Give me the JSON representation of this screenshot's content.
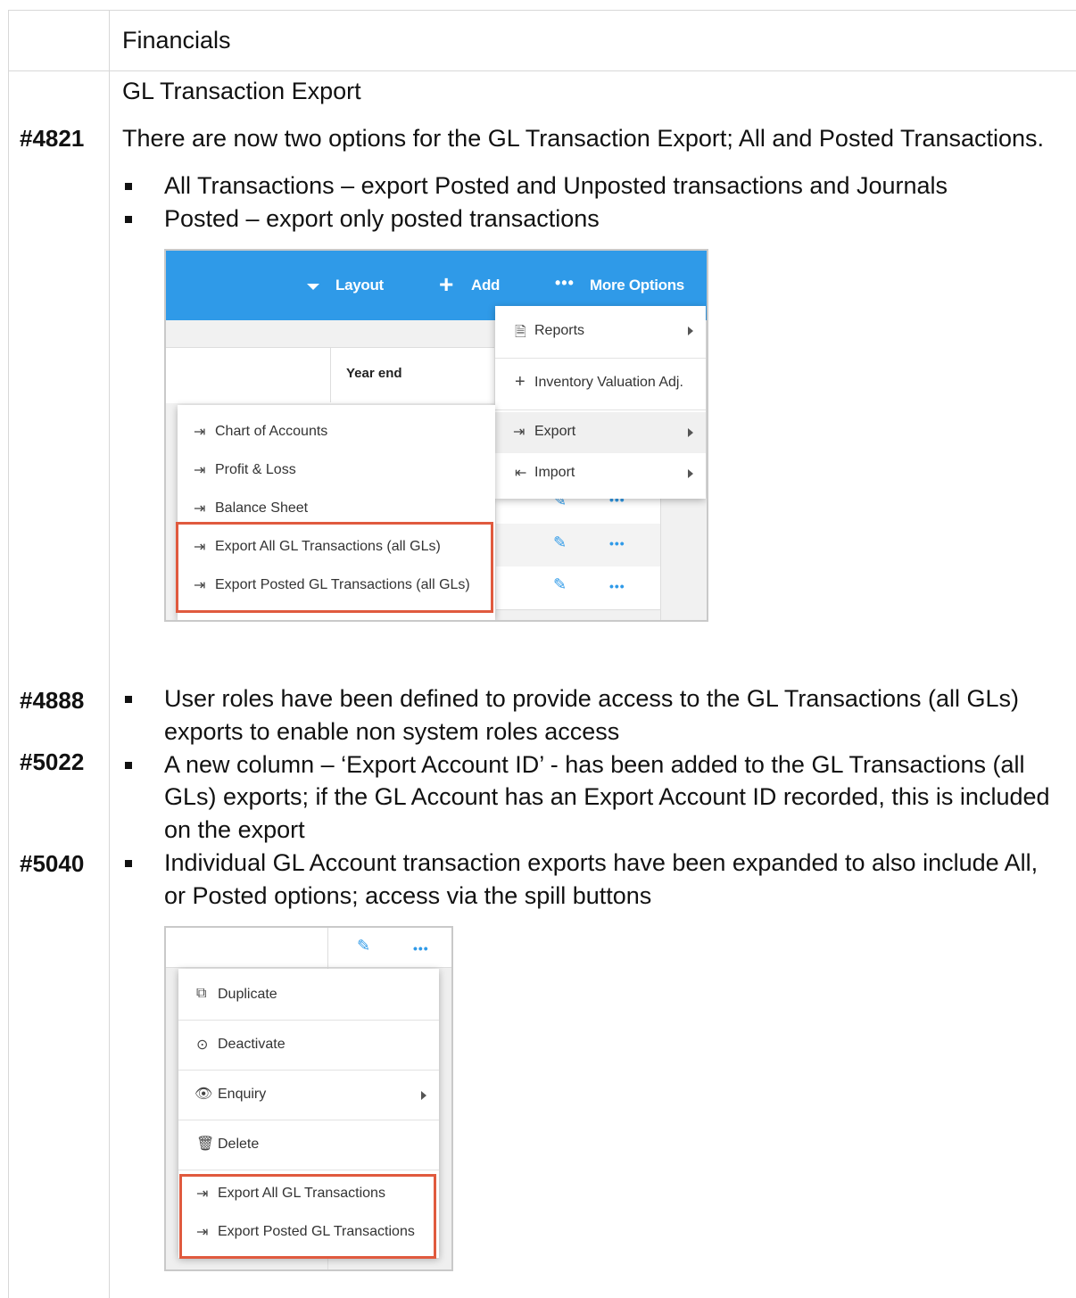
{
  "section": {
    "title": "Financials"
  },
  "subsection": {
    "title": "GL Transaction Export"
  },
  "items": [
    {
      "ref": "#4821",
      "intro": "There are now two options for the GL Transaction Export; All and Posted Transactions.",
      "bullets": [
        "All Transactions – export Posted and Unposted transactions and Journals",
        "Posted – export only posted transactions"
      ]
    },
    {
      "ref": "#4888",
      "lines": [
        "User roles have been defined to provide access to the GL Transactions (all GLs)",
        "exports to enable non system roles access"
      ]
    },
    {
      "ref": "#5022",
      "lines": [
        "A new column – ‘Export Account ID’ - has been added to the GL Transactions (all",
        "GLs) exports; if the GL Account has an Export Account ID recorded, this is included",
        "on the export"
      ]
    },
    {
      "ref": "#5040",
      "lines": [
        "Individual GL Account transaction exports have been expanded to also include All,",
        "or Posted options; access via the spill buttons"
      ]
    }
  ],
  "screenshot1": {
    "toolbar": {
      "layout": "Layout",
      "add": "Add",
      "more_options": "More Options"
    },
    "grid_header": "Year end",
    "more_menu": [
      {
        "label": "Reports",
        "icon": "report-icon",
        "submenu": true
      },
      {
        "label": "Inventory Valuation Adj.",
        "icon": "plus-icon",
        "submenu": false
      },
      {
        "label": "Export",
        "icon": "export-icon",
        "submenu": true
      },
      {
        "label": "Import",
        "icon": "import-icon",
        "submenu": true
      }
    ],
    "export_submenu": [
      "Chart of Accounts",
      "Profit & Loss",
      "Balance Sheet",
      "Export All GL Transactions (all GLs)",
      "Export Posted GL Transactions (all GLs)"
    ]
  },
  "screenshot2": {
    "spill_menu": [
      {
        "label": "Duplicate",
        "icon": "duplicate-icon",
        "submenu": false
      },
      {
        "label": "Deactivate",
        "icon": "toggle-icon",
        "submenu": false
      },
      {
        "label": "Enquiry",
        "icon": "eye-icon",
        "submenu": true
      },
      {
        "label": "Delete",
        "icon": "trash-icon",
        "submenu": false
      },
      {
        "label": "Export All GL Transactions",
        "icon": "export-icon",
        "submenu": false
      },
      {
        "label": "Export Posted GL Transactions",
        "icon": "export-icon",
        "submenu": false
      }
    ]
  },
  "colors": {
    "toolbar_blue": "#2f9ae8",
    "highlight_red": "#e05a3e"
  }
}
